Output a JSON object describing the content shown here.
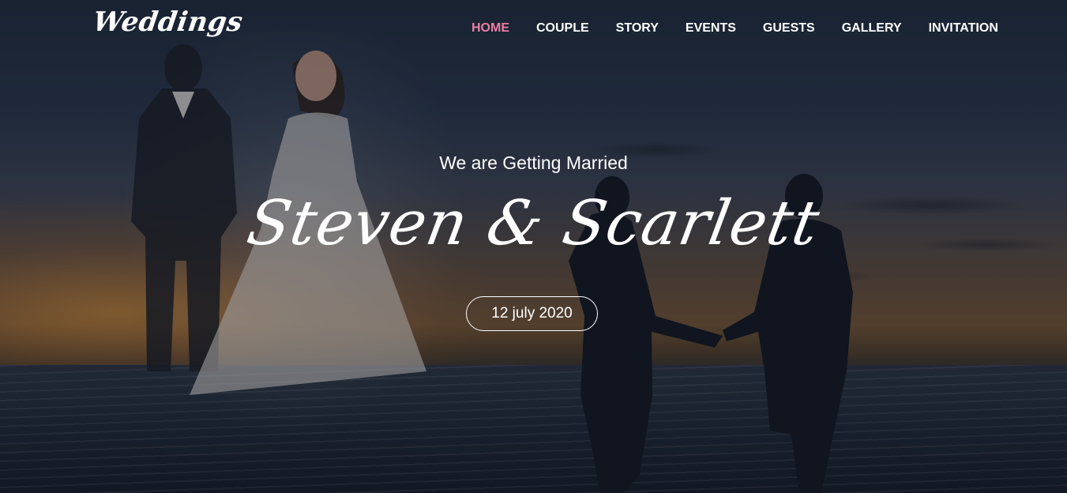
{
  "brand": {
    "logo_text": "Weddings"
  },
  "nav": {
    "items": [
      {
        "label": "HOME",
        "active": true
      },
      {
        "label": "COUPLE",
        "active": false
      },
      {
        "label": "STORY",
        "active": false
      },
      {
        "label": "EVENTS",
        "active": false
      },
      {
        "label": "GUESTS",
        "active": false
      },
      {
        "label": "GALLERY",
        "active": false
      },
      {
        "label": "INVITATION",
        "active": false
      }
    ]
  },
  "hero": {
    "intro": "We are Getting Married",
    "names": "Steven & Scarlett",
    "date": "12 july 2020"
  },
  "colors": {
    "accent": "#ea7fa4",
    "text": "#ffffff"
  }
}
